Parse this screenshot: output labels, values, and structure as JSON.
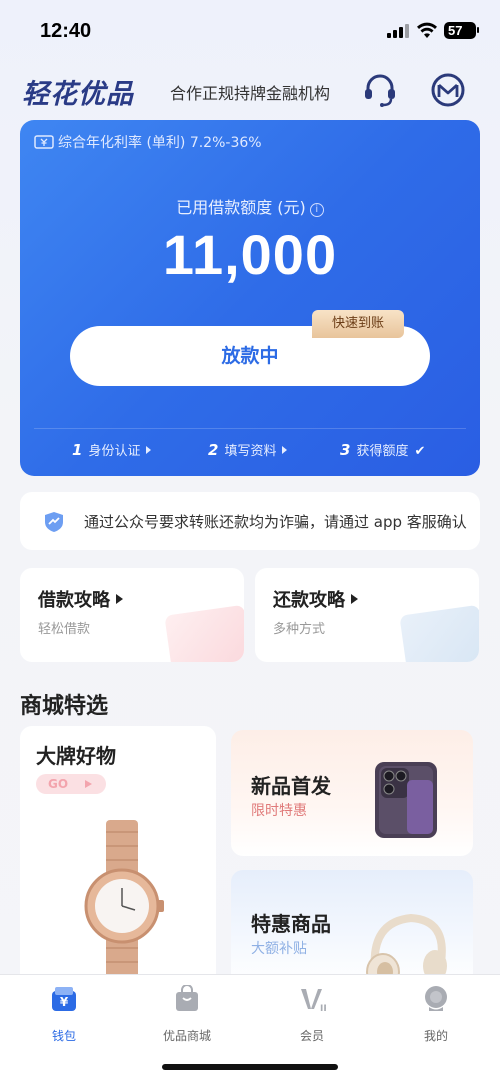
{
  "status_bar": {
    "time": "12:40",
    "battery": "57"
  },
  "header": {
    "logo": "轻花优品",
    "subtitle": "合作正规持牌金融机构",
    "customer_service_icon": "headset-icon",
    "message_icon": "message-icon"
  },
  "loan_card": {
    "rate_text": "综合年化利率 (单利) 7.2%-36%",
    "quota_label": "已用借款额度 (元)",
    "quota_amount": "11,000",
    "button_label": "放款中",
    "fast_tag": "快速到账",
    "steps": [
      {
        "num": "1",
        "label": "身份认证"
      },
      {
        "num": "2",
        "label": "填写资料"
      },
      {
        "num": "3",
        "label": "获得额度"
      }
    ],
    "colors": {
      "card_start": "#3f86f2",
      "card_end": "#2a5ee3",
      "accent": "#2c6be5"
    }
  },
  "notice": {
    "text": "通过公众号要求转账还款均为诈骗，请通过 app 客服确认"
  },
  "guides": [
    {
      "title": "借款攻略",
      "subtitle": "轻松借款"
    },
    {
      "title": "还款攻略",
      "subtitle": "多种方式"
    }
  ],
  "mall": {
    "title": "商城特选",
    "brand": {
      "title": "大牌好物",
      "go": "GO"
    },
    "new_arrival": {
      "title": "新品首发",
      "subtitle": "限时特惠"
    },
    "sale": {
      "title": "特惠商品",
      "subtitle": "大额补贴"
    }
  },
  "tabbar": [
    {
      "label": "钱包",
      "icon": "wallet-icon",
      "active": true
    },
    {
      "label": "优品商城",
      "icon": "shopping-bag-icon",
      "active": false
    },
    {
      "label": "会员",
      "icon": "vip-icon",
      "active": false
    },
    {
      "label": "我的",
      "icon": "profile-icon",
      "active": false
    }
  ]
}
